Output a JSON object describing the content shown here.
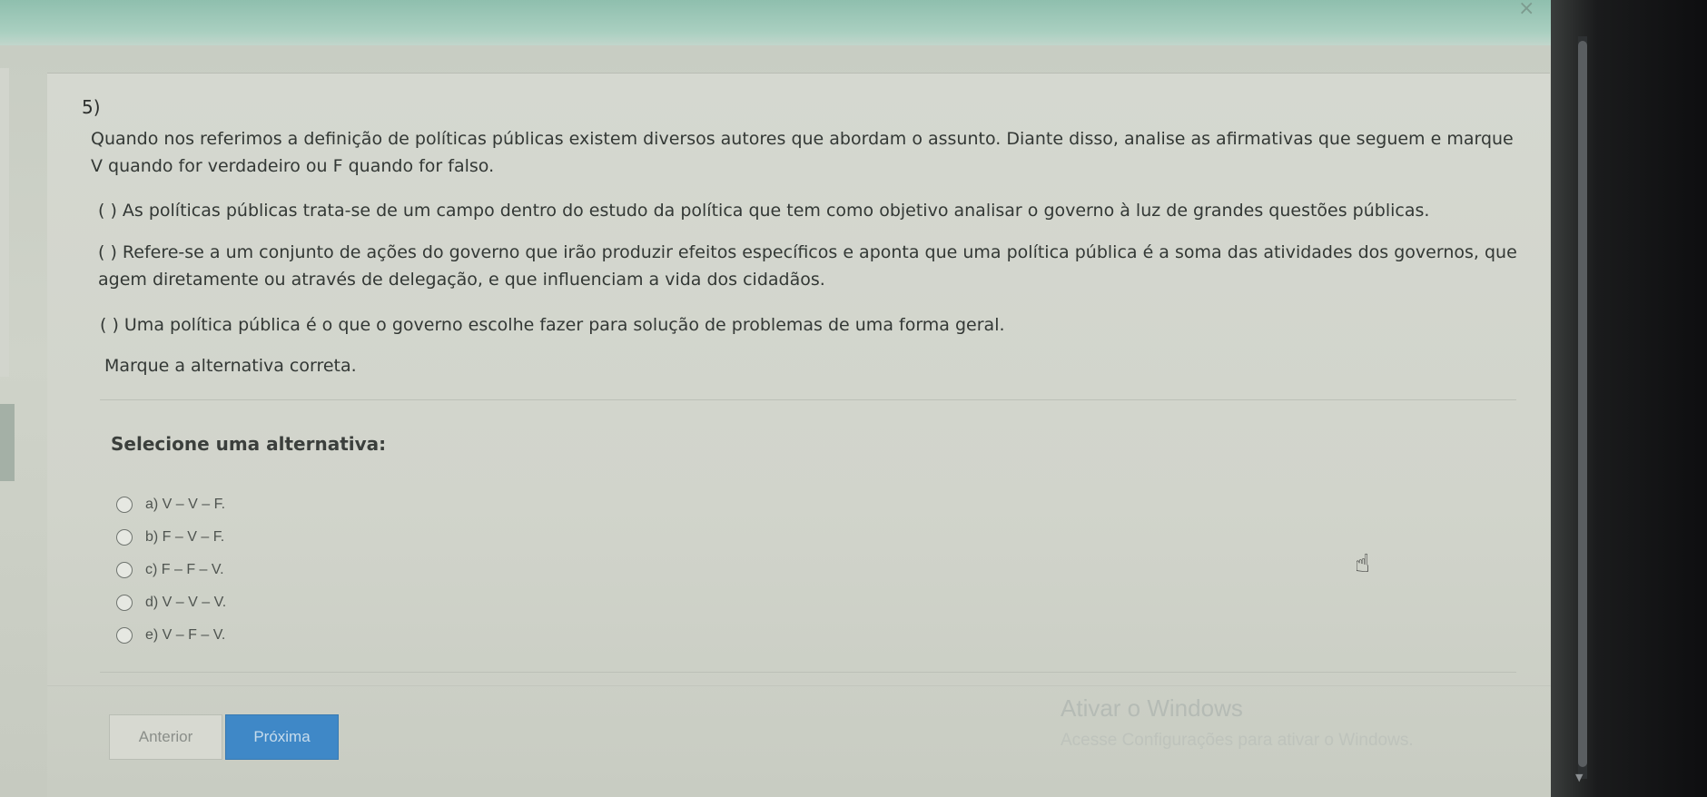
{
  "question": {
    "number": "5)",
    "intro": "Quando nos referimos a definição de políticas públicas existem diversos autores que abordam o assunto. Diante disso, analise as afirmativas que seguem e marque V quando for verdadeiro ou F quando for falso.",
    "statements": [
      "( ) As políticas públicas trata-se de um campo dentro do estudo da política que tem como objetivo analisar o governo à luz de grandes questões públicas.",
      "( ) Refere-se a um conjunto de ações do governo que irão produzir efeitos específicos e aponta que uma política pública é a soma das atividades dos governos, que agem diretamente ou através de delegação, e que influenciam a vida dos cidadãos.",
      "( ) Uma política pública é o que o governo escolhe fazer para solução de problemas de uma forma geral."
    ],
    "instruction": "Marque a alternativa correta."
  },
  "answers": {
    "title": "Selecione uma alternativa:",
    "options": [
      "a) V – V – F.",
      "b) F – V – F.",
      "c) F – F – V.",
      "d) V – V – V.",
      "e) V – F – V."
    ]
  },
  "navigation": {
    "prev_label": "Anterior",
    "next_label": "Próxima"
  },
  "watermark": {
    "line1": "Ativar o Windows",
    "line2": "Acesse Configurações para ativar o Windows."
  },
  "colors": {
    "next_button": "#3f88c7",
    "text": "#333835"
  }
}
